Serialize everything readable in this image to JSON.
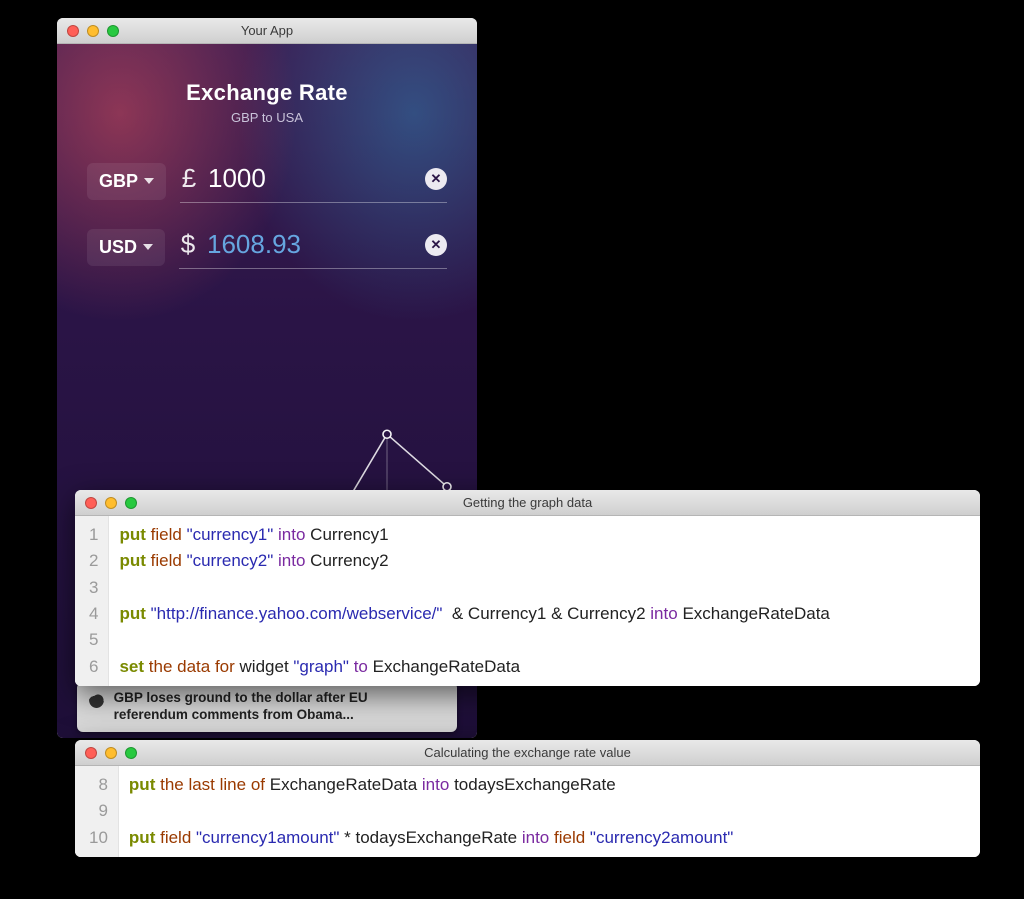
{
  "app": {
    "window_title": "Your App",
    "header_title": "Exchange Rate",
    "header_subtitle": "GBP to USA",
    "rows": [
      {
        "code": "GBP",
        "symbol": "£",
        "value": "1000"
      },
      {
        "code": "USD",
        "symbol": "$",
        "value": "1608.93"
      }
    ]
  },
  "news": {
    "text": "GBP loses ground to the dollar after EU referendum comments from Obama..."
  },
  "chart_data": {
    "type": "line",
    "title": "",
    "xlabel": "",
    "ylabel": "",
    "x": [
      0,
      1,
      2,
      3,
      4,
      5,
      6
    ],
    "values": [
      1.31,
      1.29,
      1.33,
      1.32,
      1.35,
      1.62,
      1.48
    ],
    "ylim": [
      1.25,
      1.65
    ],
    "grid": false
  },
  "code1": {
    "window_title": "Getting the graph data",
    "start_line": 1,
    "lines": [
      {
        "n": 1,
        "tokens": [
          {
            "t": "put",
            "c": "kw"
          },
          {
            "t": " "
          },
          {
            "t": "field",
            "c": "fld"
          },
          {
            "t": " "
          },
          {
            "t": "\"currency1\"",
            "c": "str"
          },
          {
            "t": " "
          },
          {
            "t": "into",
            "c": "into"
          },
          {
            "t": " "
          },
          {
            "t": "Currency1",
            "c": "id"
          }
        ]
      },
      {
        "n": 2,
        "tokens": [
          {
            "t": "put",
            "c": "kw"
          },
          {
            "t": " "
          },
          {
            "t": "field",
            "c": "fld"
          },
          {
            "t": " "
          },
          {
            "t": "\"currency2\"",
            "c": "str"
          },
          {
            "t": " "
          },
          {
            "t": "into",
            "c": "into"
          },
          {
            "t": " "
          },
          {
            "t": "Currency2",
            "c": "id"
          }
        ]
      },
      {
        "n": 3,
        "tokens": []
      },
      {
        "n": 4,
        "tokens": [
          {
            "t": "put",
            "c": "kw"
          },
          {
            "t": " "
          },
          {
            "t": "\"http://finance.yahoo.com/webservice/\"",
            "c": "str"
          },
          {
            "t": "  & Currency1 & Currency2 ",
            "c": "id"
          },
          {
            "t": "into",
            "c": "into"
          },
          {
            "t": " "
          },
          {
            "t": "ExchangeRateData",
            "c": "id"
          }
        ]
      },
      {
        "n": 5,
        "tokens": []
      },
      {
        "n": 6,
        "tokens": [
          {
            "t": "set",
            "c": "kw"
          },
          {
            "t": " "
          },
          {
            "t": "the data for",
            "c": "fld"
          },
          {
            "t": " widget "
          },
          {
            "t": "\"graph\"",
            "c": "str"
          },
          {
            "t": " "
          },
          {
            "t": "to",
            "c": "into"
          },
          {
            "t": " "
          },
          {
            "t": "ExchangeRateData",
            "c": "id"
          }
        ]
      }
    ]
  },
  "code2": {
    "window_title": "Calculating the exchange rate value",
    "start_line": 8,
    "lines": [
      {
        "n": 8,
        "tokens": [
          {
            "t": "put",
            "c": "kw"
          },
          {
            "t": " "
          },
          {
            "t": "the last line of",
            "c": "fld"
          },
          {
            "t": " "
          },
          {
            "t": "ExchangeRateData",
            "c": "id"
          },
          {
            "t": " "
          },
          {
            "t": "into",
            "c": "into"
          },
          {
            "t": " "
          },
          {
            "t": "todaysExchangeRate",
            "c": "id"
          }
        ]
      },
      {
        "n": 9,
        "tokens": []
      },
      {
        "n": 10,
        "tokens": [
          {
            "t": "put",
            "c": "kw"
          },
          {
            "t": " "
          },
          {
            "t": "field",
            "c": "fld"
          },
          {
            "t": " "
          },
          {
            "t": "\"currency1amount\"",
            "c": "str"
          },
          {
            "t": " * todaysExchangeRate ",
            "c": "id"
          },
          {
            "t": "into",
            "c": "into"
          },
          {
            "t": " "
          },
          {
            "t": "field",
            "c": "fld"
          },
          {
            "t": " "
          },
          {
            "t": "\"currency2amount\"",
            "c": "str"
          }
        ]
      }
    ]
  }
}
